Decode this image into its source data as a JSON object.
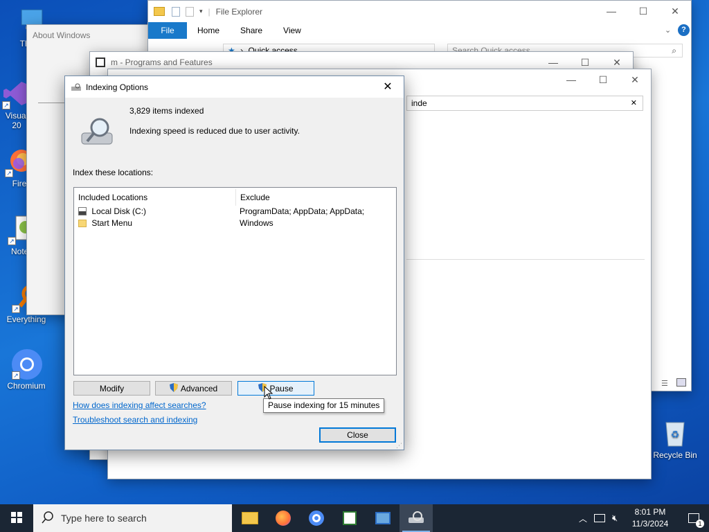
{
  "desktop": {
    "icons": [
      {
        "label": "This",
        "icon": "this-pc-icon"
      },
      {
        "label": "Visual\n20",
        "icon": "visual-studio-icon"
      },
      {
        "label": "Fire",
        "icon": "firefox-icon"
      },
      {
        "label": "Notep",
        "icon": "notepad-plus-icon"
      },
      {
        "label": "Everything",
        "icon": "everything-icon"
      },
      {
        "label": "Chromium",
        "icon": "chromium-icon"
      },
      {
        "label": "Recycle Bin",
        "icon": "recycle-bin-icon"
      }
    ]
  },
  "about_windows": {
    "title": "About Windows"
  },
  "file_explorer": {
    "title": "File Explorer",
    "ribbon_tabs": [
      "File",
      "Home",
      "Share",
      "View"
    ],
    "address": "Quick access",
    "search_placeholder": "Search Quick access"
  },
  "programs_features": {
    "title": "m - Programs and Features"
  },
  "search_window": {
    "search_value": "inde",
    "clear_glyph": "✕"
  },
  "indexing_dialog": {
    "title": "Indexing Options",
    "items_indexed": "3,829 items indexed",
    "status": "Indexing speed is reduced due to user activity.",
    "locations_label": "Index these locations:",
    "columns": [
      "Included Locations",
      "Exclude"
    ],
    "rows": [
      {
        "location": "Local Disk (C:)",
        "exclude": "ProgramData; AppData; AppData; Windows"
      },
      {
        "location": "Start Menu",
        "exclude": ""
      }
    ],
    "buttons": {
      "modify": "Modify",
      "advanced": "Advanced",
      "pause": "Pause",
      "close": "Close"
    },
    "tooltip": "Pause indexing for 15 minutes",
    "links": {
      "affect": "How does indexing affect searches?",
      "troubleshoot": "Troubleshoot search and indexing"
    }
  },
  "taskbar": {
    "search_placeholder": "Type here to search",
    "time": "8:01 PM",
    "date": "11/3/2024",
    "notification_count": "1"
  },
  "colors": {
    "accent": "#0063b1",
    "taskbar": "#1b2634",
    "link": "#0066cc"
  }
}
